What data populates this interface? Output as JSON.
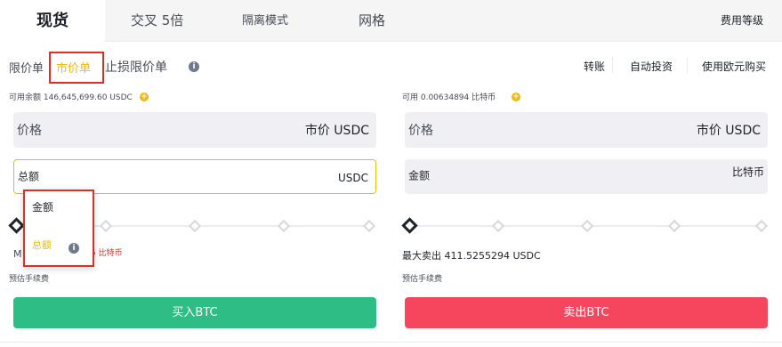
{
  "tabs": [
    {
      "label": "现货",
      "active": true
    },
    {
      "label": "交叉 5倍",
      "active": false
    },
    {
      "label": "隔离模式",
      "active": false
    },
    {
      "label": "网格",
      "active": false
    }
  ],
  "fee_level": "费用等级",
  "order_types": {
    "limit": "限价单",
    "market": "市价单",
    "stop_limit": "止损限价单"
  },
  "links": {
    "transfer": "转账",
    "auto_invest": "自动投资",
    "buy_eur": "使用欧元购买"
  },
  "buy_panel": {
    "available": "可用余额 146,645,699.60 USDC",
    "price_label": "价格",
    "price_value": "市价 USDC",
    "total_label": "总额",
    "total_unit": "USDC",
    "max_prefix": "M",
    "max_suffix": "5 比特币",
    "fee_label": "预估手续费",
    "button": "买入BTC"
  },
  "sell_panel": {
    "available": "可用 0.00634894 比特币",
    "price_label": "价格",
    "price_value": "市价 USDC",
    "amount_label": "金额",
    "amount_unit": "比特币",
    "max_sell": "最大卖出 411.5255294 USDC",
    "fee_label": "预估手续费",
    "button": "卖出BTC"
  },
  "dropdown": {
    "options": [
      "金额",
      "总额"
    ],
    "selected": "总额"
  },
  "colors": {
    "accent": "#f0b90b",
    "buy": "#2ebd85",
    "sell": "#f6465d",
    "highlight_box": "#d93025"
  },
  "icons": [
    "info-icon",
    "plus-icon",
    "slider-handle-icon"
  ]
}
